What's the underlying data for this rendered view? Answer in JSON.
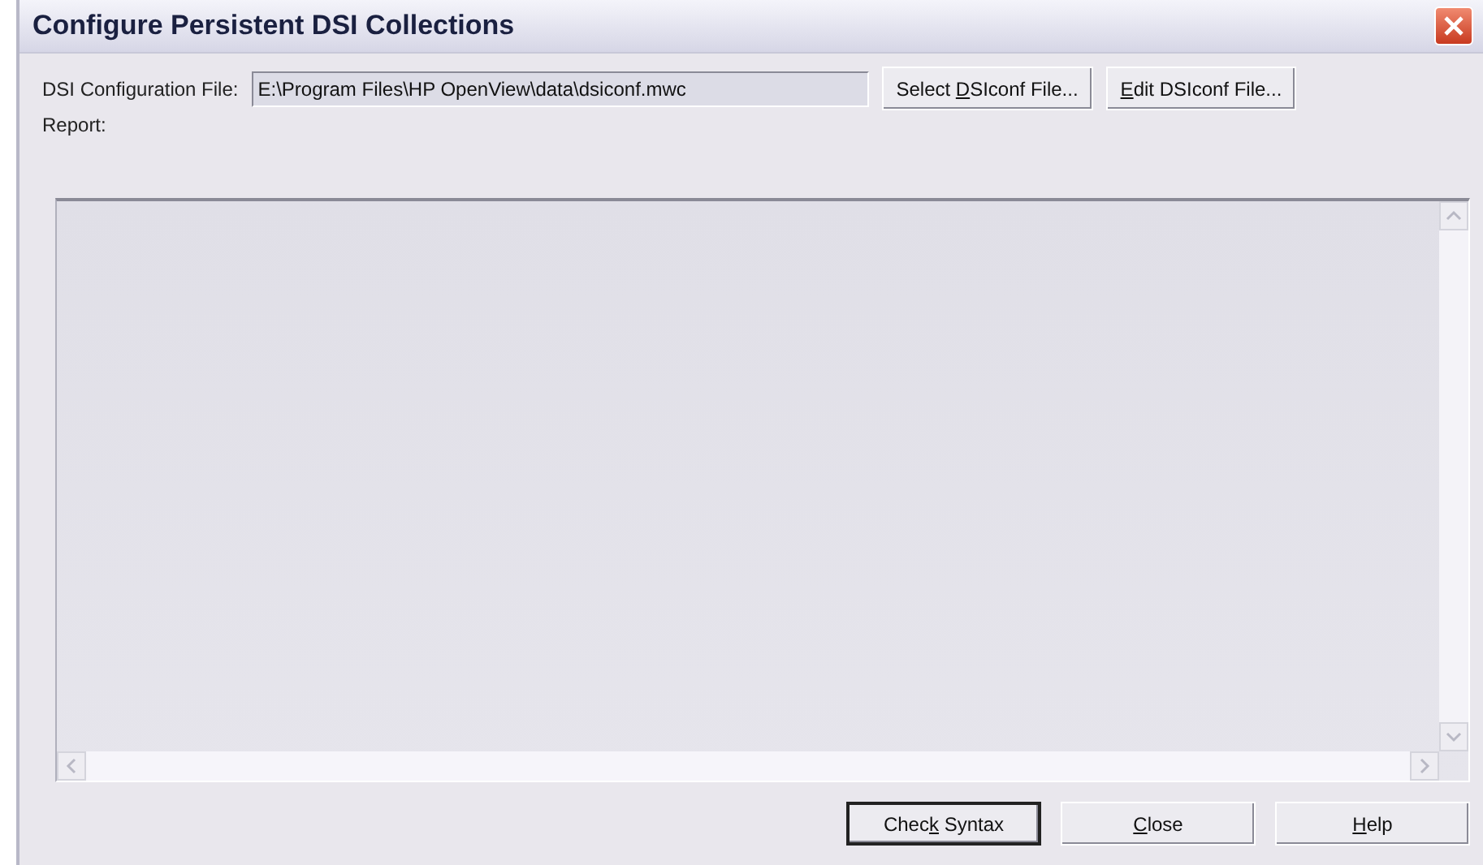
{
  "window": {
    "title": "Configure Persistent DSI Collections"
  },
  "config_file": {
    "label": "DSI Configuration File:",
    "value": "E:\\Program Files\\HP OpenView\\data\\dsiconf.mwc"
  },
  "file_buttons": [
    {
      "before": "Select ",
      "key": "D",
      "after": "SIconf File...",
      "default": false
    },
    {
      "key": "E",
      "after": "dit DSIconf File...",
      "default": false
    }
  ],
  "report": {
    "label": "Report:"
  },
  "buttons": [
    {
      "before": "Chec",
      "key": "k",
      "after": " Syntax",
      "default": true
    },
    {
      "key": "C",
      "after": "lose",
      "default": false
    },
    {
      "key": "H",
      "after": "elp",
      "default": false
    }
  ]
}
